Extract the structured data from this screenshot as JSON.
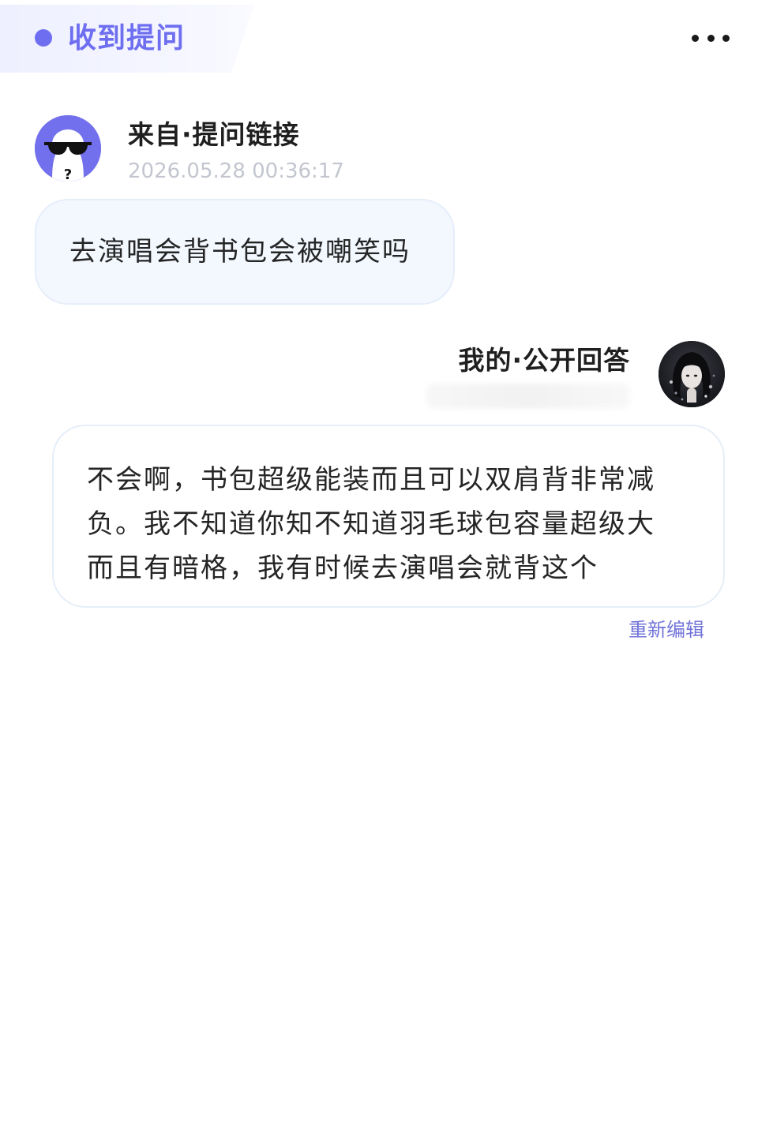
{
  "header": {
    "title": "收到提问",
    "more_icon": "more-horizontal-icon",
    "accent_color": "#6e6ef0"
  },
  "question": {
    "source_label": "来自·提问链接",
    "timestamp": "2026.05.28 00:36:17",
    "avatar_icon": "anonymous-sunglasses-avatar-icon",
    "avatar_color": "#7270ec",
    "text": "去演唱会背书包会被嘲笑吗"
  },
  "answer": {
    "label": "我的·公开回答",
    "avatar_icon": "user-photo-avatar",
    "text": "不会啊，书包超级能装而且可以双肩背非常减负。我不知道你知不知道羽毛球包容量超级大而且有暗格，我有时候去演唱会就背这个",
    "reedit_label": "重新编辑",
    "link_color": "#7274d8"
  }
}
